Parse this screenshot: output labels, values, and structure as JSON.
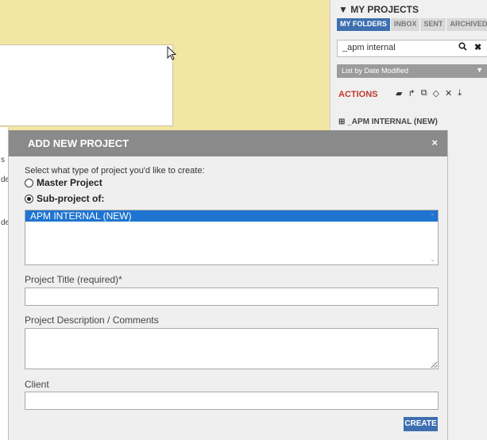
{
  "right_panel": {
    "heading": "▼ MY PROJECTS",
    "tabs": [
      "MY FOLDERS",
      "INBOX",
      "SENT",
      "ARCHIVED"
    ],
    "search_value": "_apm internal",
    "sort_label": "List by Date Modified",
    "actions_label": "ACTIONS",
    "tree_item": "⊞  _APM INTERNAL (NEW)"
  },
  "left_edge": {
    "fragments": [
      "s",
      "de",
      "de"
    ]
  },
  "modal": {
    "title": "ADD NEW PROJECT",
    "close": "×",
    "prompt": "Select what type of project you'd like to create:",
    "option_master": "Master Project",
    "option_sub": "Sub-project of:",
    "selected_option": "sub",
    "list_items": [
      "APM INTERNAL (NEW)"
    ],
    "title_label": "Project Title (required)*",
    "title_value": "",
    "description_label": "Project Description / Comments",
    "description_value": "",
    "client_label": "Client",
    "client_value": "",
    "create_label": "CREATE"
  },
  "colors": {
    "accent": "#3e6fb0",
    "selection": "#1e74d0",
    "actions": "#c0392b",
    "modal_header": "#8a8a8a"
  }
}
